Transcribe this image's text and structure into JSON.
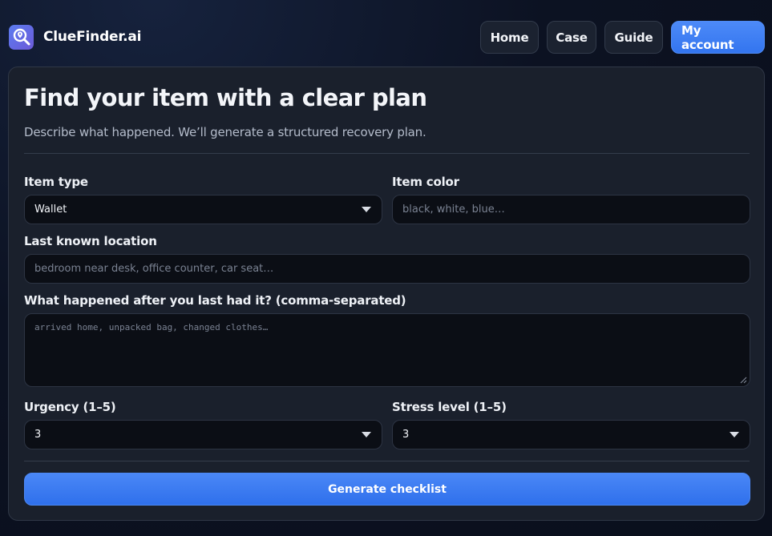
{
  "app": {
    "name": "ClueFinder.ai"
  },
  "nav": {
    "items": [
      {
        "label": "Home"
      },
      {
        "label": "Case"
      },
      {
        "label": "Guide"
      },
      {
        "label": "My account"
      }
    ]
  },
  "form": {
    "title": "Find your item with a clear plan",
    "subtitle": "Describe what happened. We’ll generate a structured recovery plan.",
    "item_type": {
      "label": "Item type",
      "value": "Wallet"
    },
    "item_color": {
      "label": "Item color",
      "placeholder": "black, white, blue…"
    },
    "location": {
      "label": "Last known location",
      "placeholder": "bedroom near desk, office counter, car seat…"
    },
    "events": {
      "label": "What happened after you last had it? (comma-separated)",
      "placeholder": "arrived home, unpacked bag, changed clothes…"
    },
    "urgency": {
      "label": "Urgency (1–5)",
      "value": "3"
    },
    "stress": {
      "label": "Stress level (1–5)",
      "value": "3"
    },
    "submit_label": "Generate checklist"
  },
  "colors": {
    "accent": "#3b7cf2",
    "background": "#0c1222",
    "card": "#1a202c",
    "field": "#0b0e15"
  }
}
